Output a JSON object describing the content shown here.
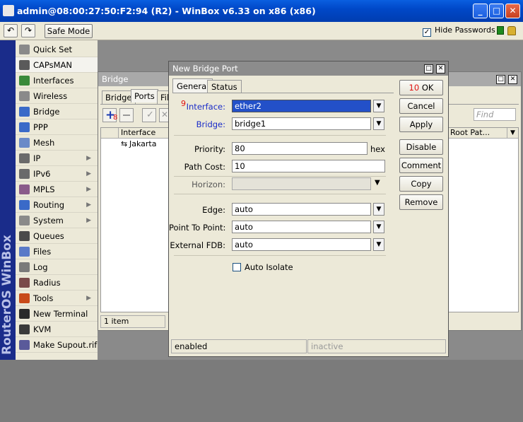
{
  "window": {
    "title": "admin@08:00:27:50:F2:94 (R2) - WinBox v6.33 on x86 (x86)"
  },
  "toolbar": {
    "undo_icon": "undo-icon",
    "redo_icon": "redo-icon",
    "safe_mode": "Safe Mode",
    "hide_passwords": "Hide Passwords",
    "hide_passwords_checked": true
  },
  "sidebar": {
    "vertical_label": "RouterOS WinBox",
    "items": [
      {
        "label": "Quick Set",
        "icon": "quick-set-icon",
        "color": "#8a8a8a",
        "submenu": false
      },
      {
        "label": "CAPsMAN",
        "icon": "capsman-icon",
        "color": "#5a5a5a",
        "submenu": false
      },
      {
        "label": "Interfaces",
        "icon": "interfaces-icon",
        "color": "#3a8a3a",
        "submenu": false
      },
      {
        "label": "Wireless",
        "icon": "wireless-icon",
        "color": "#8a8a8a",
        "submenu": false
      },
      {
        "label": "Bridge",
        "icon": "bridge-icon",
        "color": "#3a6ac8",
        "submenu": false
      },
      {
        "label": "PPP",
        "icon": "ppp-icon",
        "color": "#3a6ac8",
        "submenu": false
      },
      {
        "label": "Mesh",
        "icon": "mesh-icon",
        "color": "#6a8ac8",
        "submenu": false
      },
      {
        "label": "IP",
        "icon": "ip-icon",
        "color": "#6a6a6a",
        "submenu": true
      },
      {
        "label": "IPv6",
        "icon": "ipv6-icon",
        "color": "#6a6a6a",
        "submenu": true
      },
      {
        "label": "MPLS",
        "icon": "mpls-icon",
        "color": "#8a5a8a",
        "submenu": true
      },
      {
        "label": "Routing",
        "icon": "routing-icon",
        "color": "#3a6ac8",
        "submenu": true
      },
      {
        "label": "System",
        "icon": "system-icon",
        "color": "#8a8a8a",
        "submenu": true
      },
      {
        "label": "Queues",
        "icon": "queues-icon",
        "color": "#4a4a4a",
        "submenu": false
      },
      {
        "label": "Files",
        "icon": "files-icon",
        "color": "#5a7ac8",
        "submenu": false
      },
      {
        "label": "Log",
        "icon": "log-icon",
        "color": "#7a7a7a",
        "submenu": false
      },
      {
        "label": "Radius",
        "icon": "radius-icon",
        "color": "#7a4a4a",
        "submenu": false
      },
      {
        "label": "Tools",
        "icon": "tools-icon",
        "color": "#c84a1a",
        "submenu": true
      },
      {
        "label": "New Terminal",
        "icon": "terminal-icon",
        "color": "#2a2a2a",
        "submenu": false
      },
      {
        "label": "KVM",
        "icon": "kvm-icon",
        "color": "#3a3a3a",
        "submenu": false
      },
      {
        "label": "Make Supout.rif",
        "icon": "supout-icon",
        "color": "#5a5a9a",
        "submenu": false
      }
    ]
  },
  "bridge_window": {
    "title": "Bridge",
    "tabs": [
      "Bridge",
      "Ports",
      "Fil"
    ],
    "active_tab": "Ports",
    "add_annotation": "8",
    "find_placeholder": "Find",
    "columns": [
      "Interface",
      "Root Pat..."
    ],
    "rows": [
      {
        "interface": "Jakarta"
      }
    ],
    "item_count": "1 item"
  },
  "dialog": {
    "title": "New Bridge Port",
    "tabs": [
      "General",
      "Status"
    ],
    "active_tab": "General",
    "interface_annotation": "9",
    "fields": {
      "interface": {
        "label": "Interface:",
        "value": "ether2"
      },
      "bridge": {
        "label": "Bridge:",
        "value": "bridge1"
      },
      "priority": {
        "label": "Priority:",
        "value": "80",
        "unit": "hex"
      },
      "path_cost": {
        "label": "Path Cost:",
        "value": "10"
      },
      "horizon": {
        "label": "Horizon:",
        "value": ""
      },
      "edge": {
        "label": "Edge:",
        "value": "auto"
      },
      "point_to_point": {
        "label": "Point To Point:",
        "value": "auto"
      },
      "external_fdb": {
        "label": "External FDB:",
        "value": "auto"
      },
      "auto_isolate": {
        "label": "Auto Isolate",
        "checked": false
      }
    },
    "buttons": {
      "ok_annotation": "10",
      "ok": "OK",
      "cancel": "Cancel",
      "apply": "Apply",
      "disable": "Disable",
      "comment": "Comment",
      "copy": "Copy",
      "remove": "Remove"
    },
    "status": {
      "left": "enabled",
      "right": "inactive"
    }
  }
}
